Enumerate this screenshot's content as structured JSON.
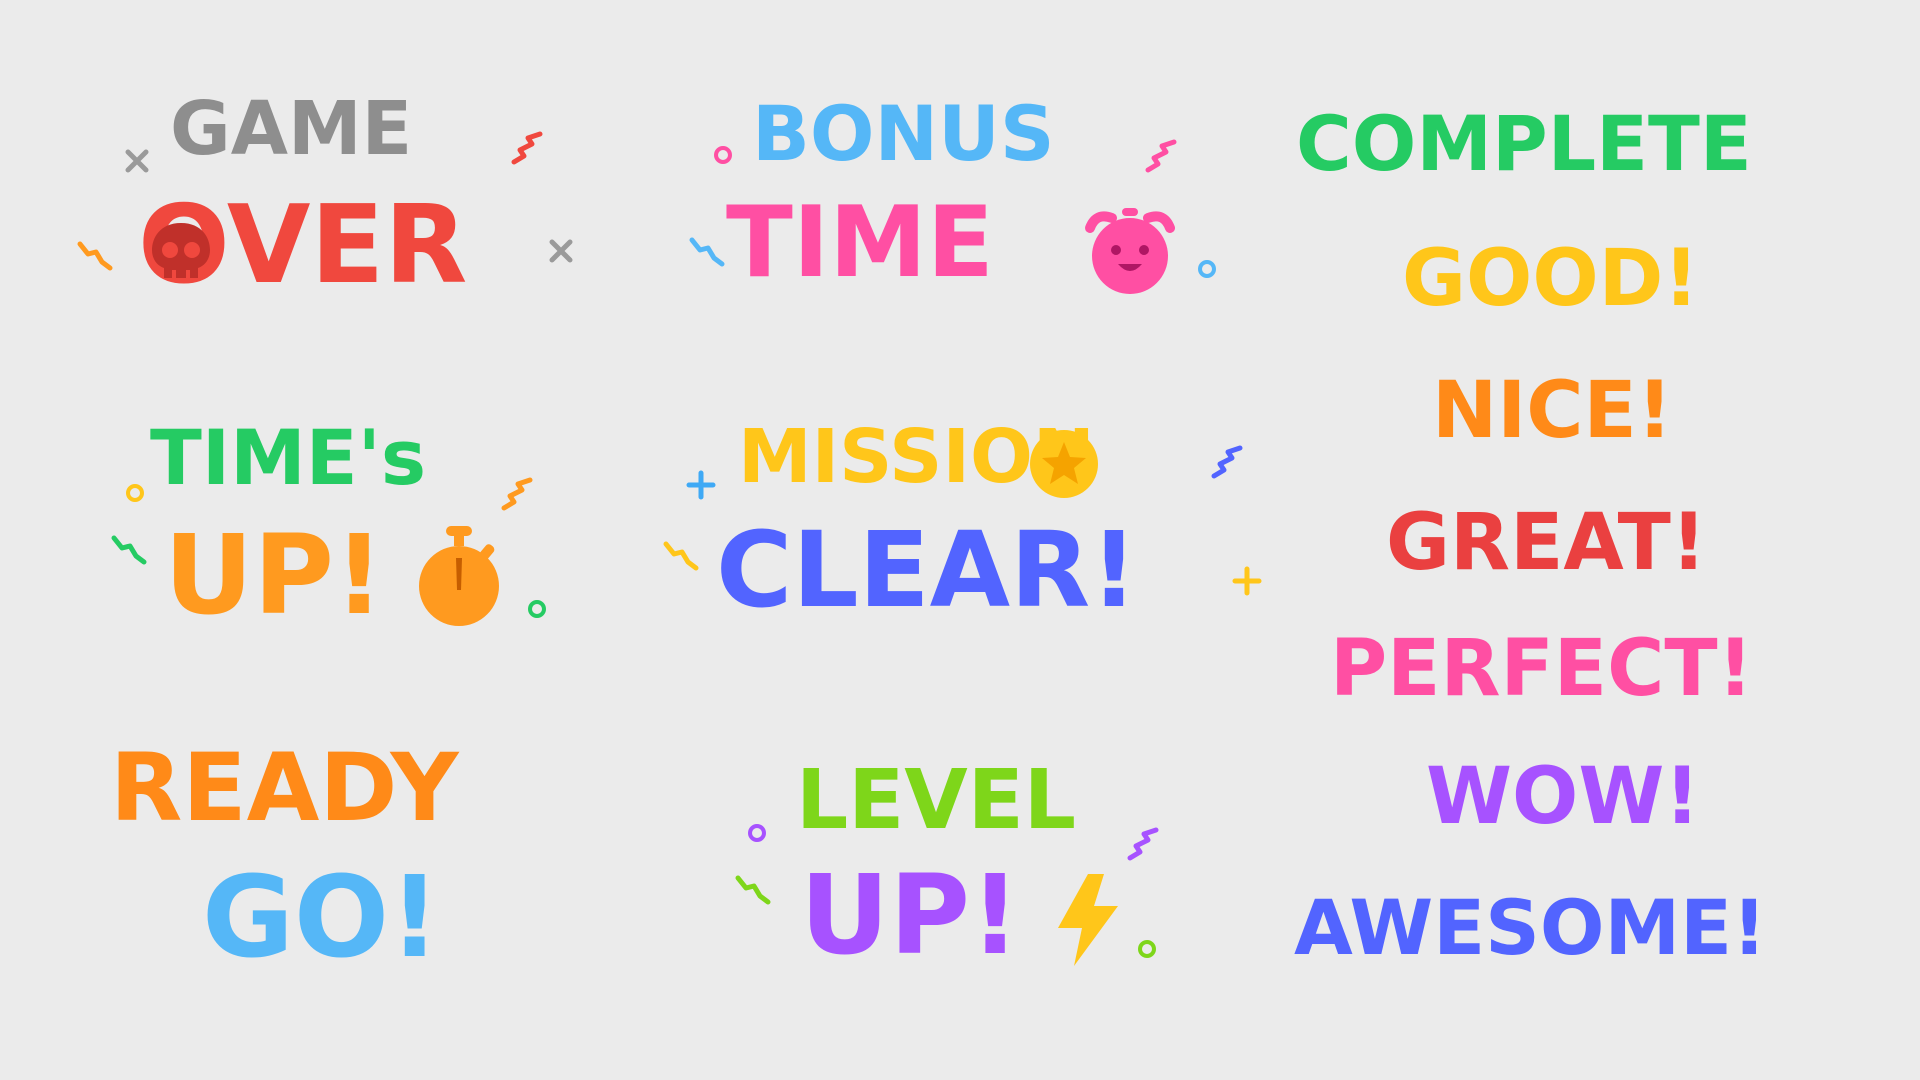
{
  "stickers": {
    "game_over": {
      "line1": "GAME",
      "line2": "OVER"
    },
    "bonus_time": {
      "line1": "BONUS",
      "line2": "TIME"
    },
    "times_up": {
      "line1": "TIME's",
      "line2": "UP!"
    },
    "mission_clear": {
      "line1": "MISSION",
      "line2": "CLEAR!"
    },
    "ready_go": {
      "line1": "READY",
      "line2": "GO!"
    },
    "level_up": {
      "line1": "LEVEL",
      "line2": "UP!"
    }
  },
  "words": [
    "COMPLETE",
    "GOOD!",
    "NICE!",
    "GREAT!",
    "PERFECT!",
    "WOW!",
    "AWESOME!"
  ],
  "colors": {
    "background": "#ebebeb",
    "gray": "#8e8e8e",
    "red": "#f0483e",
    "sky": "#55b7f7",
    "pink": "#ff4fa3",
    "green": "#25cb63",
    "orange": "#ff9a1f",
    "yellow": "#ffc61a",
    "indigo": "#5264ff",
    "lime": "#7ed61a",
    "purple": "#a752ff",
    "blue": "#3fa9f5",
    "dark_orange": "#ff8a18",
    "crimson": "#ea4040"
  },
  "icons": [
    "skull-icon",
    "alarm-clock-icon",
    "stopwatch-icon",
    "star-icon",
    "lightning-bolt-icon"
  ]
}
